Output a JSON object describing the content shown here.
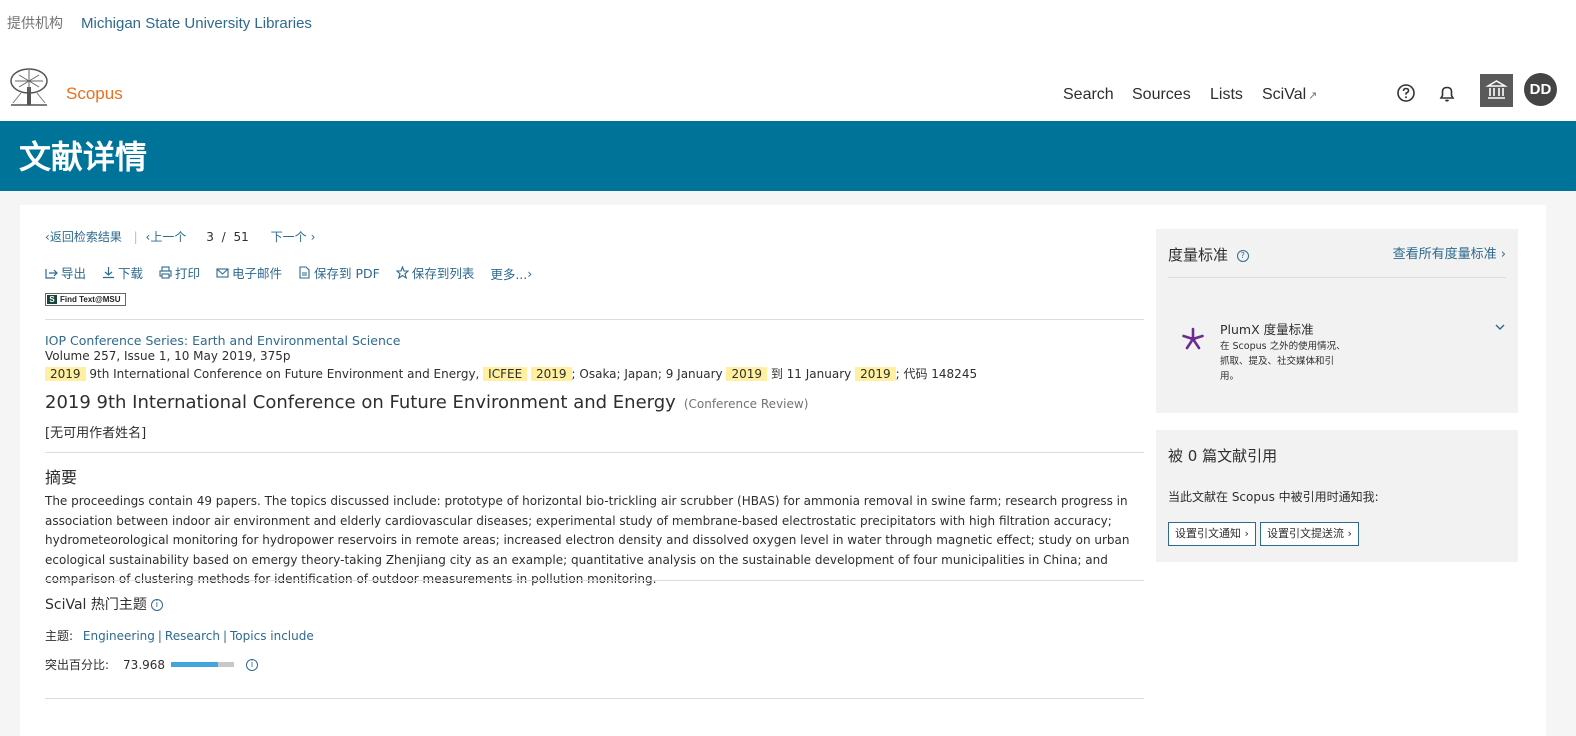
{
  "institution": {
    "label": "提供机构",
    "name": "Michigan State University Libraries"
  },
  "header": {
    "brand": "Scopus",
    "nav": {
      "search": "Search",
      "sources": "Sources",
      "lists": "Lists",
      "scival": "SciVal",
      "scival_ext": "↗"
    },
    "avatar": "DD",
    "icons": [
      "help-icon",
      "bell-icon",
      "institution-icon"
    ]
  },
  "banner": {
    "title": "文献详情"
  },
  "doc_nav": {
    "back": "返回检索结果",
    "prev": "上一个",
    "current": "3",
    "total": "51",
    "next": "下一个",
    "divider": "|",
    "of": "/"
  },
  "actions": {
    "export": "导出",
    "download": "下载",
    "print": "打印",
    "email": "电子邮件",
    "save_pdf": "保存到 PDF",
    "save_list": "保存到列表",
    "more": "更多..."
  },
  "findtext": {
    "label": "Find Text@MSU",
    "badge": "S"
  },
  "source": {
    "title": "IOP Conference Series: Earth and Environmental Science",
    "volume": "Volume 257, Issue 1, 10 May 2019, 375p",
    "conf_parts": {
      "y1": "2019",
      "t1": " 9th International Conference on Future Environment and Energy, ",
      "icfee": "ICFEE",
      "y2": "2019",
      "t2": "; Osaka; Japan; 9 January ",
      "y3": "2019",
      "t3": " 到 11 January ",
      "y4": "2019",
      "t4": "; 代码 148245"
    }
  },
  "document": {
    "title": "2019 9th International Conference on Future Environment and Energy",
    "type": "(Conference Review)",
    "authors": "[无可用作者姓名]"
  },
  "abstract": {
    "heading": "摘要",
    "text": "The proceedings contain 49 papers. The topics discussed include: prototype of horizontal bio-trickling air scrubber (HBAS) for ammonia removal in swine farm; research progress in association between indoor air environment and elderly cardiovascular diseases; experimental study of membrane-based electrostatic precipitators with high filtration accuracy; hydrometeorological monitoring for hydropower reservoirs in remote areas; increased electron density and dissolved oxygen level in water through magnetic effect; study on urban ecological sustainability based on emergy theory-taking Zhenjiang city as an example; quantitative analysis on the sustainable development of four municipalities in China; and comparison of clustering methods for identification of outdoor measurements in pollution monitoring."
  },
  "scival": {
    "heading": "SciVal 热门主题",
    "topic_label": "主题:",
    "topics": [
      "Engineering",
      "Research",
      "Topics include"
    ],
    "topic_sep": "|",
    "percentile_label": "突出百分比:",
    "percentile_value": "73.968",
    "percentile_fraction": 0.73968
  },
  "metrics": {
    "title": "度量标准",
    "view_all": "查看所有度量标准",
    "plumx_title": "PlumX 度量标准",
    "plumx_desc": "在 Scopus 之外的使用情况、抓取、提及、社交媒体和引用。"
  },
  "cited": {
    "title": "被 0 篇文献引用",
    "notify_text": "当此文献在 Scopus 中被引用时通知我:",
    "btn_alert": "设置引文通知",
    "btn_feed": "设置引文提送流"
  },
  "colors": {
    "brand_orange": "#e9711c",
    "banner_blue": "#007398",
    "link_blue": "#2e6a8e",
    "highlight": "#fff0a0"
  }
}
